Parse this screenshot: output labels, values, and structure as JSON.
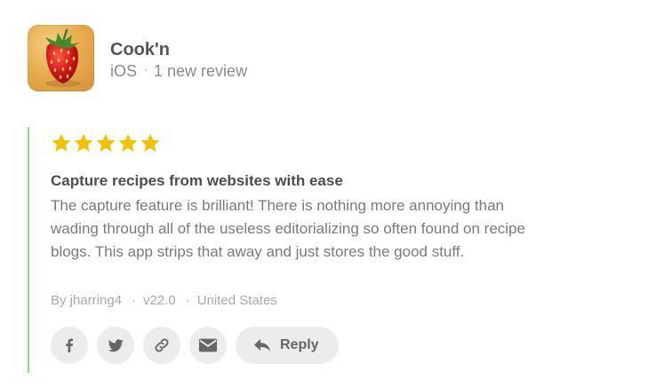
{
  "app": {
    "name": "Cook'n",
    "platform": "iOS",
    "separator": "·",
    "review_count": "1 new review",
    "icon": "strawberry-app-icon"
  },
  "review": {
    "rating": 5,
    "max_rating": 5,
    "star_color": "#f2c200",
    "accent_color": "#8fd88c",
    "title": "Capture recipes from websites with ease",
    "body": "The capture feature is brilliant! There is nothing more annoying than wading through all of the useless editorializing so often found on recipe blogs. This app strips that away and just stores the good stuff.",
    "meta": {
      "author": "By jharring4",
      "version": "v22.0",
      "country": "United States",
      "separator": "·"
    }
  },
  "actions": {
    "share_icons": [
      "facebook-icon",
      "twitter-icon",
      "link-icon",
      "email-icon"
    ],
    "reply_label": "Reply",
    "reply_icon": "reply-arrow-icon"
  }
}
